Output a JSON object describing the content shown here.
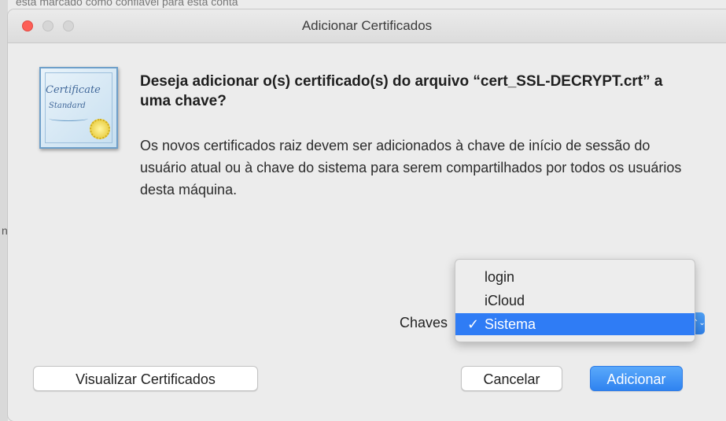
{
  "backdrop": {
    "top_text": "esta marcado como confiável para esta conta",
    "left_mark": "n"
  },
  "window": {
    "title": "Adicionar Certificados",
    "traffic_lights": [
      "close",
      "minimize",
      "zoom"
    ]
  },
  "icon": {
    "name": "certificate-icon",
    "line1": "Certificate",
    "line2": "Standard"
  },
  "dialog": {
    "heading": "Deseja adicionar o(s) certificado(s) do arquivo “cert_SSL-DECRYPT.crt” a uma chave?",
    "body": "Os novos certificados raiz devem ser adicionados à chave de início de sessão do usuário atual ou à chave do sistema para serem compartilhados por todos os usuários desta máquina."
  },
  "keychain": {
    "label": "Chaves",
    "options": [
      "login",
      "iCloud",
      "Sistema"
    ],
    "selected": "Sistema",
    "check_glyph": "✓",
    "arrows_glyph": "⌃⌄"
  },
  "buttons": {
    "view_certificates": "Visualizar Certificados",
    "cancel": "Cancelar",
    "add": "Adicionar"
  },
  "colors": {
    "accent": "#2f7cf5",
    "close": "#fd5f57",
    "window_bg": "#ececec"
  }
}
